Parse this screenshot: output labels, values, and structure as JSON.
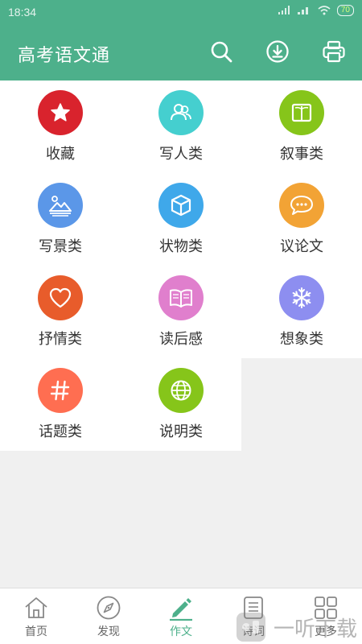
{
  "status": {
    "time": "18:34",
    "battery": "70"
  },
  "header": {
    "title": "高考语文通"
  },
  "categories": [
    {
      "label": "收藏",
      "icon": "star-icon",
      "color": "#d9232d"
    },
    {
      "label": "写人类",
      "icon": "people-icon",
      "color": "#45cfcf"
    },
    {
      "label": "叙事类",
      "icon": "book-icon",
      "color": "#86c51a"
    },
    {
      "label": "写景类",
      "icon": "mountain-icon",
      "color": "#5b97e8"
    },
    {
      "label": "状物类",
      "icon": "cube-icon",
      "color": "#3fa8ea"
    },
    {
      "label": "议论文",
      "icon": "chat-bubble-icon",
      "color": "#f2a335"
    },
    {
      "label": "抒情类",
      "icon": "heart-icon",
      "color": "#e85c2b"
    },
    {
      "label": "读后感",
      "icon": "open-book-icon",
      "color": "#e07fcd"
    },
    {
      "label": "想象类",
      "icon": "snowflake-icon",
      "color": "#8d8ef0"
    },
    {
      "label": "话题类",
      "icon": "hashtag-icon",
      "color": "#ff6e51"
    },
    {
      "label": "说明类",
      "icon": "globe-icon",
      "color": "#86c51a"
    }
  ],
  "tabs": [
    {
      "label": "首页",
      "icon": "home-icon",
      "active": false
    },
    {
      "label": "发现",
      "icon": "compass-icon",
      "active": false
    },
    {
      "label": "作文",
      "icon": "pencil-icon",
      "active": true
    },
    {
      "label": "诗词",
      "icon": "document-icon",
      "active": false
    },
    {
      "label": "更多",
      "icon": "grid-icon",
      "active": false
    }
  ],
  "watermark": {
    "text": "一听下载"
  },
  "colors": {
    "primary": "#4db08b",
    "inactive": "#666666"
  }
}
